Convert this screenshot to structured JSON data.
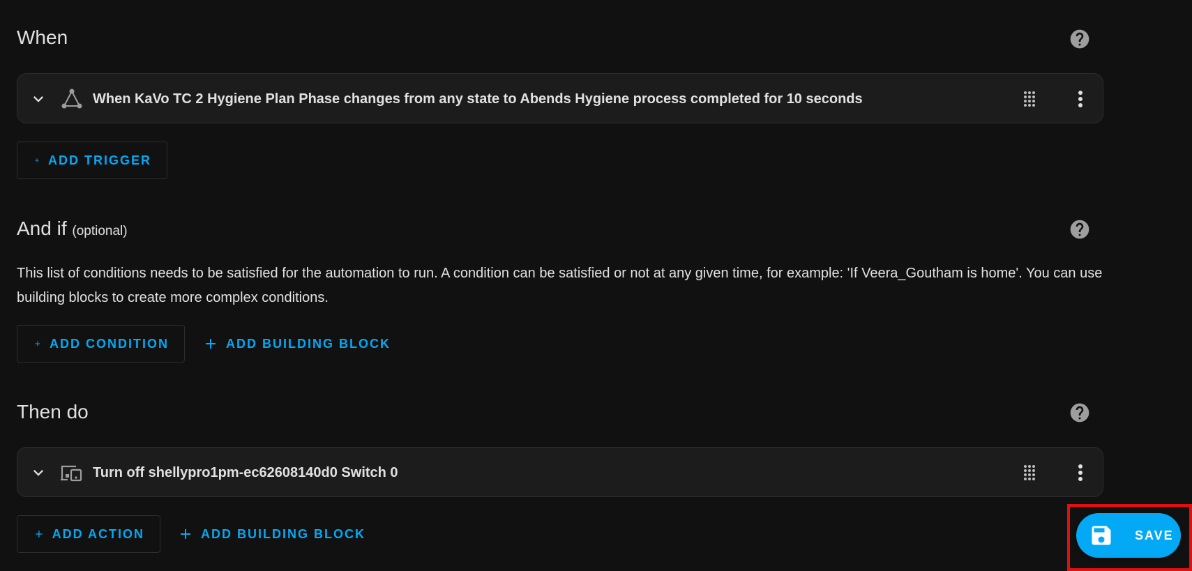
{
  "when": {
    "title": "When",
    "help_icon": "help-circle-icon",
    "trigger": {
      "text": "When KaVo TC 2 Hygiene Plan Phase changes from any state to Abends Hygiene process completed for 10 seconds",
      "icon": "state-trigger-icon"
    },
    "add_trigger_label": "ADD TRIGGER"
  },
  "and_if": {
    "title": "And if",
    "optional": "(optional)",
    "description": "This list of conditions needs to be satisfied for the automation to run. A condition can be satisfied or not at any given time, for example: 'If Veera_Goutham is home'. You can use building blocks to create more complex conditions.",
    "add_condition_label": "ADD CONDITION",
    "add_building_block_label": "ADD BUILDING BLOCK"
  },
  "then_do": {
    "title": "Then do",
    "action": {
      "text": "Turn off shellypro1pm-ec62608140d0 Switch 0",
      "icon": "devices-icon"
    },
    "add_action_label": "ADD ACTION",
    "add_building_block_label": "ADD BUILDING BLOCK"
  },
  "save": {
    "label": "SAVE",
    "icon": "content-save-icon"
  },
  "colors": {
    "accent": "#03a9f4",
    "background": "#111111",
    "card": "#1c1c1c",
    "highlight": "#e01010"
  }
}
